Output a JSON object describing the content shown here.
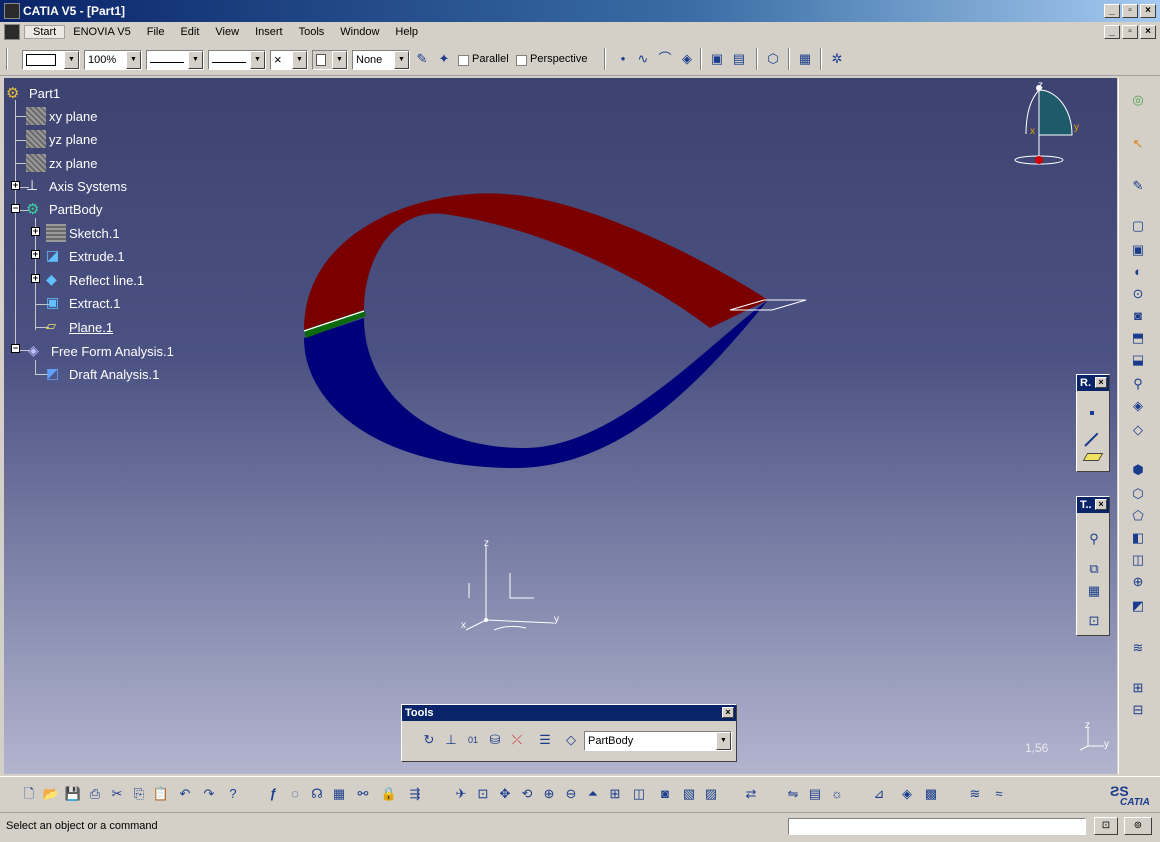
{
  "window": {
    "title": "CATIA V5 - [Part1]",
    "min": "_",
    "max": "▫",
    "close": "×"
  },
  "menu": {
    "items": [
      "Start",
      "ENOVIA V5",
      "File",
      "Edit",
      "View",
      "Insert",
      "Tools",
      "Window",
      "Help"
    ]
  },
  "toolbar": {
    "zoom_value": "100%",
    "layer_value": "None",
    "parallel_label": "Parallel",
    "perspective_label": "Perspective",
    "cross_glyph": "×"
  },
  "tree": {
    "root": "Part1",
    "xy": "xy plane",
    "yz": "yz plane",
    "zx": "zx plane",
    "axis": "Axis Systems",
    "partbody": "PartBody",
    "sketch": "Sketch.1",
    "extrude": "Extrude.1",
    "reflect": "Reflect line.1",
    "extract": "Extract.1",
    "plane": "Plane.1",
    "ffa": "Free Form Analysis.1",
    "draft": "Draft Analysis.1"
  },
  "compass": {
    "z": "z",
    "x": "x",
    "y": "y"
  },
  "axis_triad": {
    "z": "z",
    "x": "x",
    "y": "y"
  },
  "corner": {
    "scale": "1,56",
    "z": "z",
    "y": "y"
  },
  "palettes": {
    "r_title": "R.",
    "t_title": "T..",
    "close": "×"
  },
  "tools_palette": {
    "title": "Tools",
    "close": "×",
    "body_value": "PartBody"
  },
  "status": {
    "message": "Select an object or a command"
  },
  "logo": {
    "text": "CATIA"
  },
  "colors": {
    "surface_red": "#7a0000",
    "surface_blue": "#00007a",
    "background_top": "#3d4370",
    "background_bottom": "#b3b5cf"
  }
}
